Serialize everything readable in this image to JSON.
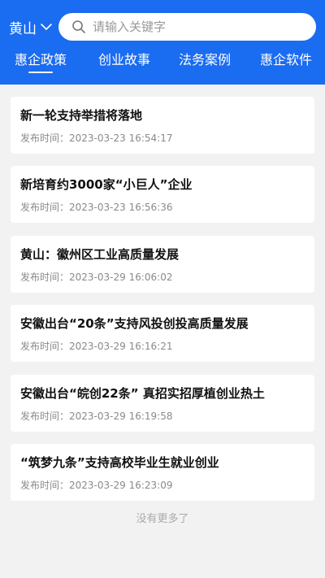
{
  "header": {
    "city": "黄山",
    "search_placeholder": "请输入关键字",
    "tabs": [
      {
        "label": "惠企政策",
        "active": true
      },
      {
        "label": "创业故事",
        "active": false
      },
      {
        "label": "法务案例",
        "active": false
      },
      {
        "label": "惠企软件",
        "active": false
      }
    ]
  },
  "time_prefix": "发布时间：",
  "articles": [
    {
      "title": "新一轮支持举措将落地",
      "time": "2023-03-23 16:54:17"
    },
    {
      "title": "新培育约3000家“小巨人”企业",
      "time": "2023-03-23 16:56:36"
    },
    {
      "title": "黄山：徽州区工业高质量发展",
      "time": "2023-03-29 16:06:02"
    },
    {
      "title": "安徽出台“20条”支持风投创投高质量发展",
      "time": "2023-03-29 16:16:21"
    },
    {
      "title": "安徽出台“皖创22条” 真招实招厚植创业热土",
      "time": "2023-03-29 16:19:58"
    },
    {
      "title": "“筑梦九条”支持高校毕业生就业创业",
      "time": "2023-03-29 16:23:09"
    }
  ],
  "footer": {
    "no_more": "没有更多了"
  },
  "colors": {
    "brand": "#1a6cf0",
    "background": "#f2f2f2"
  }
}
